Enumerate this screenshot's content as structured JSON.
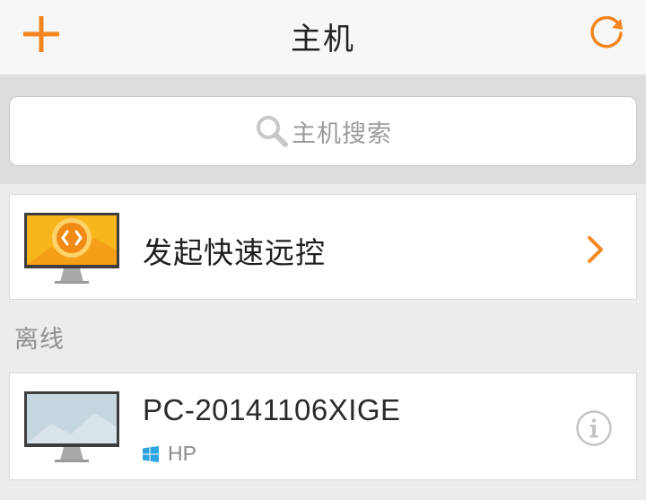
{
  "header": {
    "title": "主机",
    "accent_color": "#f5861f"
  },
  "search": {
    "placeholder": "主机搜索"
  },
  "quick_remote": {
    "label": "发起快速远控"
  },
  "offline_section": {
    "label": "离线",
    "hosts": [
      {
        "name": "PC-20141106XIGE",
        "os_label": "HP",
        "os_icon": "windows-icon"
      }
    ]
  }
}
